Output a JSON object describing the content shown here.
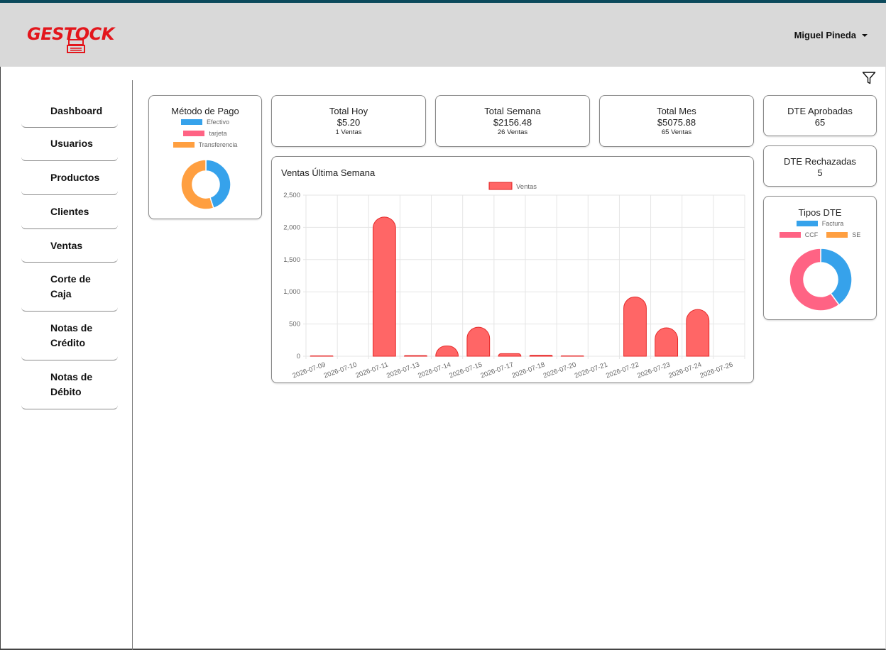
{
  "app": {
    "logo_text": "GESTOCK",
    "user_name": "Miguel Pineda"
  },
  "sidebar": {
    "items": [
      {
        "label": "Dashboard"
      },
      {
        "label": "Usuarios"
      },
      {
        "label": "Productos"
      },
      {
        "label": "Clientes"
      },
      {
        "label": "Ventas"
      },
      {
        "label": "Corte de Caja"
      },
      {
        "label": "Notas de Crédito"
      },
      {
        "label": "Notas de Débito"
      }
    ]
  },
  "colors": {
    "blue": "#36a2eb",
    "pink": "#ff6384",
    "orange": "#ff9f40",
    "red_bar": "#ff6666",
    "brand_red": "#e3161c"
  },
  "metodo_pago": {
    "title": "Método de Pago",
    "legend": [
      "Efectivo",
      "tarjeta",
      "Transferencia"
    ]
  },
  "totals": {
    "hoy": {
      "title": "Total Hoy",
      "value": "$5.20",
      "sub": "1 Ventas"
    },
    "semana": {
      "title": "Total Semana",
      "value": "$2156.48",
      "sub": "26 Ventas"
    },
    "mes": {
      "title": "Total Mes",
      "value": "$5075.88",
      "sub": "65 Ventas"
    }
  },
  "dte": {
    "aprobadas": {
      "title": "DTE Aprobadas",
      "value": "65"
    },
    "rechazadas": {
      "title": "DTE Rechazadas",
      "value": "5"
    }
  },
  "tipos_dte": {
    "title": "Tipos DTE",
    "legend": [
      "Factura",
      "CCF",
      "SE"
    ]
  },
  "ventas_chart": {
    "title": "Ventas Última Semana"
  },
  "chart_data": [
    {
      "type": "pie",
      "title": "Método de Pago",
      "labels": [
        "Efectivo",
        "tarjeta",
        "Transferencia"
      ],
      "values": [
        45,
        0,
        55
      ],
      "colors": [
        "#36a2eb",
        "#ff6384",
        "#ff9f40"
      ],
      "style": "doughnut"
    },
    {
      "type": "bar",
      "title": "Ventas Última Semana",
      "categories": [
        "2026-07-09",
        "2026-07-10",
        "2026-07-11",
        "2026-07-13",
        "2026-07-14",
        "2026-07-15",
        "2026-07-17",
        "2026-07-18",
        "2026-07-20",
        "2026-07-21",
        "2026-07-22",
        "2026-07-23",
        "2026-07-24",
        "2026-07-26"
      ],
      "series": [
        {
          "name": "Ventas",
          "values": [
            5,
            0,
            2160,
            10,
            160,
            450,
            40,
            15,
            5,
            0,
            920,
            440,
            725,
            0
          ]
        }
      ],
      "ylim": [
        0,
        2500
      ],
      "yticks": [
        0,
        500,
        1000,
        1500,
        2000,
        2500
      ],
      "ytick_labels": [
        "0",
        "500",
        "1,000",
        "1,500",
        "2,000",
        "2,500"
      ],
      "grid": true,
      "legend": "top-center"
    },
    {
      "type": "pie",
      "title": "Tipos DTE",
      "labels": [
        "Factura",
        "CCF",
        "SE"
      ],
      "values": [
        40,
        60,
        0
      ],
      "colors": [
        "#36a2eb",
        "#ff6384",
        "#ff9f40"
      ],
      "style": "doughnut"
    }
  ]
}
